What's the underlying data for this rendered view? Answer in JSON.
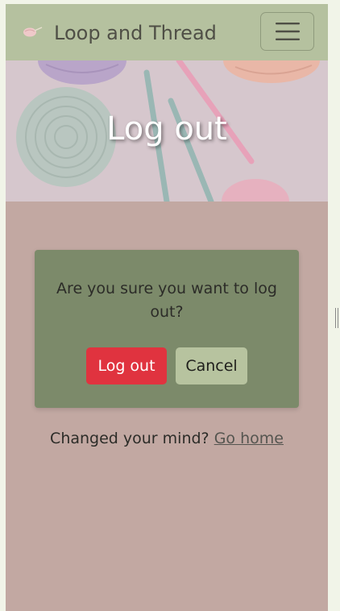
{
  "navbar": {
    "brand_name": "Loop and Thread",
    "logo_icon": "yarn-ball-icon",
    "toggle_icon": "hamburger-menu-icon"
  },
  "hero": {
    "title": "Log out"
  },
  "logout_card": {
    "message": "Are you sure you want to log out?",
    "logout_button": "Log out",
    "cancel_button": "Cancel"
  },
  "footer_prompt": {
    "text": "Changed your mind?",
    "link": "Go home"
  },
  "colors": {
    "navbar_bg": "#b5c19f",
    "page_bg": "#c2a8a2",
    "card_bg": "#7c8a6a",
    "danger_button": "#e0333f",
    "cancel_button": "#b7c39f"
  }
}
